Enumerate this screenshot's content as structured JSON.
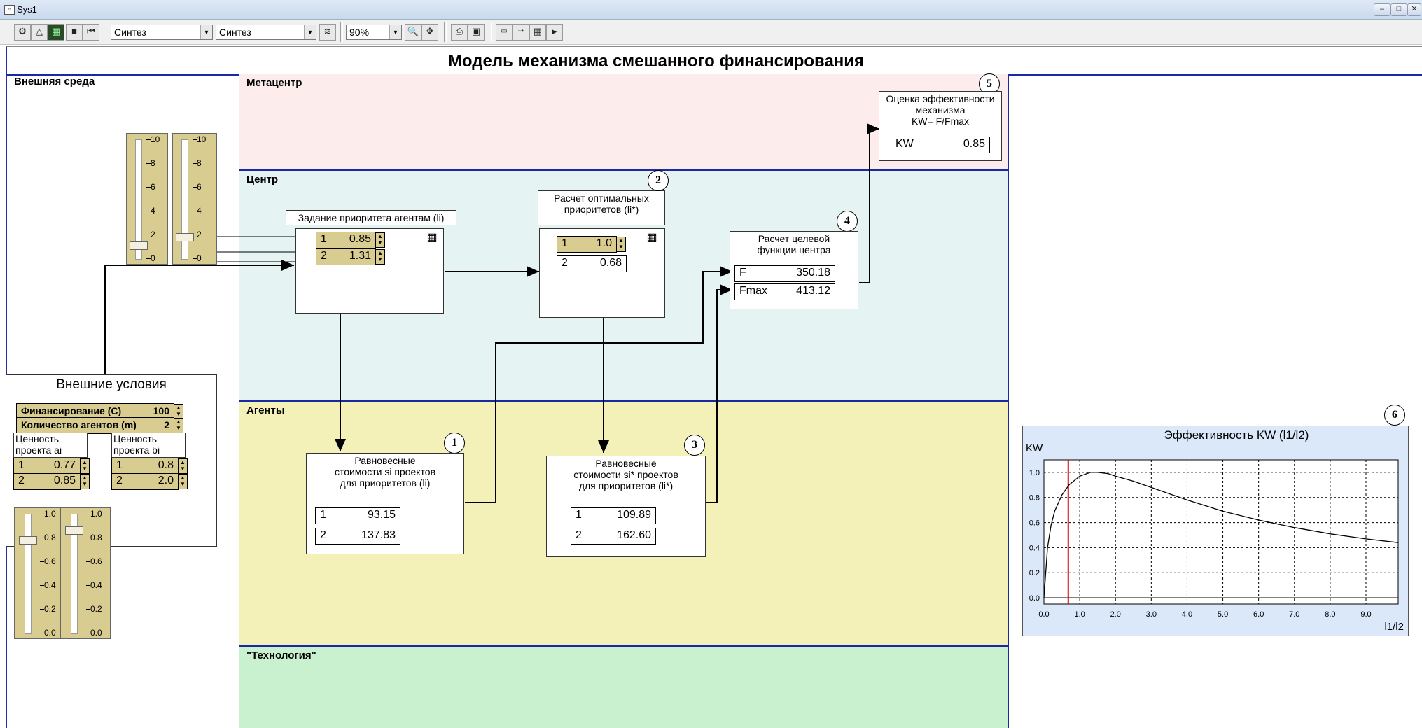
{
  "window": {
    "title": "Sys1",
    "minimize": "–",
    "maximize": "□",
    "close": "✕"
  },
  "toolbar": {
    "combo1": "Синтез",
    "combo2": "Синтез",
    "zoom": "90%"
  },
  "model_title": "Модель механизма смешанного финансирования",
  "zones": {
    "external": "Внешняя среда",
    "metacenter": "Метацентр",
    "center": "Центр",
    "agents": "Агенты",
    "technology": "\"Технология\""
  },
  "sliders_top": {
    "ticks": [
      "10",
      "8",
      "6",
      "4",
      "2",
      "0"
    ]
  },
  "sliders_bottom": {
    "ticks": [
      "1.0",
      "0.8",
      "0.6",
      "0.4",
      "0.2",
      "0.0"
    ]
  },
  "priority_block": {
    "title": "Задание приоритета агентам (li)",
    "rows": [
      {
        "k": "1",
        "v": "0.85"
      },
      {
        "k": "2",
        "v": "1.31"
      }
    ]
  },
  "optimal_block": {
    "title_line1": "Расчет оптимальных",
    "title_line2": "приоритетов (li*)",
    "num": "2",
    "rows": [
      {
        "k": "1",
        "v": "1.0"
      },
      {
        "k": "2",
        "v": "0.68"
      }
    ]
  },
  "target_block": {
    "title_line1": "Расчет целевой",
    "title_line2": "функции центра",
    "num": "4",
    "rows": [
      {
        "k": "F",
        "v": "350.18"
      },
      {
        "k": "Fmax",
        "v": "413.12"
      }
    ]
  },
  "kw_block": {
    "title_line1": "Оценка эффективности",
    "title_line2": "механизма",
    "title_line3": "KW= F/Fmax",
    "num": "5",
    "k": "KW",
    "v": "0.85"
  },
  "external_conditions": {
    "title": "Внешние условия",
    "financing_label": "Финансирование (C)",
    "financing_value": "100",
    "agents_label": "Количество агентов (m)",
    "agents_value": "2",
    "a_title_line1": "Ценность",
    "a_title_line2": "проекта  ai",
    "a_rows": [
      {
        "k": "1",
        "v": "0.77"
      },
      {
        "k": "2",
        "v": "0.85"
      }
    ],
    "b_title_line1": "Ценность",
    "b_title_line2": "проекта  bi",
    "b_rows": [
      {
        "k": "1",
        "v": "0.8"
      },
      {
        "k": "2",
        "v": "2.0"
      }
    ]
  },
  "equil_block_1": {
    "title_line1": "Равновесные",
    "title_line2": "стоимости si проектов",
    "title_line3": "для приоритетов (li)",
    "num": "1",
    "rows": [
      {
        "k": "1",
        "v": "93.15"
      },
      {
        "k": "2",
        "v": "137.83"
      }
    ]
  },
  "equil_block_3": {
    "title_line1": "Равновесные",
    "title_line2": "стоимости si* проектов",
    "title_line3": "для приоритетов (li*)",
    "num": "3",
    "rows": [
      {
        "k": "1",
        "v": "109.89"
      },
      {
        "k": "2",
        "v": "162.60"
      }
    ]
  },
  "chart_panel": {
    "num": "6"
  },
  "chart_data": {
    "type": "line",
    "title": "Эффективность KW (l1/l2)",
    "ylabel": "KW",
    "xlabel": "l1/l2",
    "xlim": [
      0,
      9.9
    ],
    "ylim": [
      -0.05,
      1.1
    ],
    "xticks": [
      "0.0",
      "1.0",
      "2.0",
      "3.0",
      "4.0",
      "5.0",
      "6.0",
      "7.0",
      "8.0",
      "9.0"
    ],
    "yticks": [
      "1.0",
      "0.8",
      "0.6",
      "0.4",
      "0.2",
      "0.0"
    ],
    "grid": true,
    "series": [
      {
        "x": [
          0.0,
          0.1,
          0.2,
          0.3,
          0.5,
          0.7,
          1.0,
          1.3,
          1.5,
          1.8,
          2.0,
          2.5,
          3.0,
          3.5,
          4.0,
          5.0,
          6.0,
          7.0,
          8.0,
          9.0,
          9.9
        ],
        "values": [
          0.0,
          0.4,
          0.58,
          0.69,
          0.82,
          0.9,
          0.97,
          1.0,
          1.0,
          0.99,
          0.97,
          0.93,
          0.88,
          0.83,
          0.78,
          0.69,
          0.62,
          0.56,
          0.51,
          0.47,
          0.44
        ]
      }
    ],
    "marker_x": 0.68,
    "colors": {
      "line": "#000000",
      "marker": "#d00000",
      "plot_bg": "#ffffff",
      "panel_bg": "#dbe8fa"
    }
  },
  "colors": {
    "metacenter_bg": "#fdecec",
    "center_bg": "#e6f3f3",
    "agents_bg": "#f3f0b8",
    "technology_bg": "#c9f1cf",
    "zone_border": "#1a2aa0",
    "slider_bg": "#d8cc90"
  }
}
